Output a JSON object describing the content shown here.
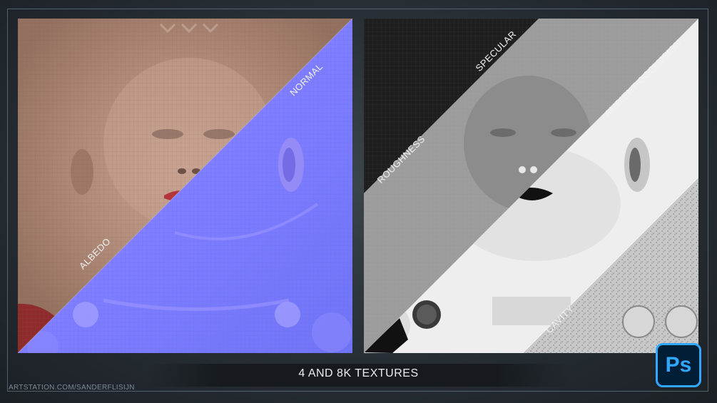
{
  "panels": {
    "left": {
      "labels": {
        "albedo": "ALBEDO",
        "normal": "NORMAL"
      }
    },
    "right": {
      "labels": {
        "specular": "SPECULAR",
        "roughness": "ROUGHNESS",
        "ambient_occlusion": "AMBIENT OCCLUSION",
        "cavity": "CAVITY"
      }
    }
  },
  "caption": "4 AND 8K TEXTURES",
  "credit": "ARTSTATION.COM/SANDERFLISIJN",
  "logo": {
    "text": "Ps",
    "color": "#31a8ff",
    "background": "#001e36"
  }
}
